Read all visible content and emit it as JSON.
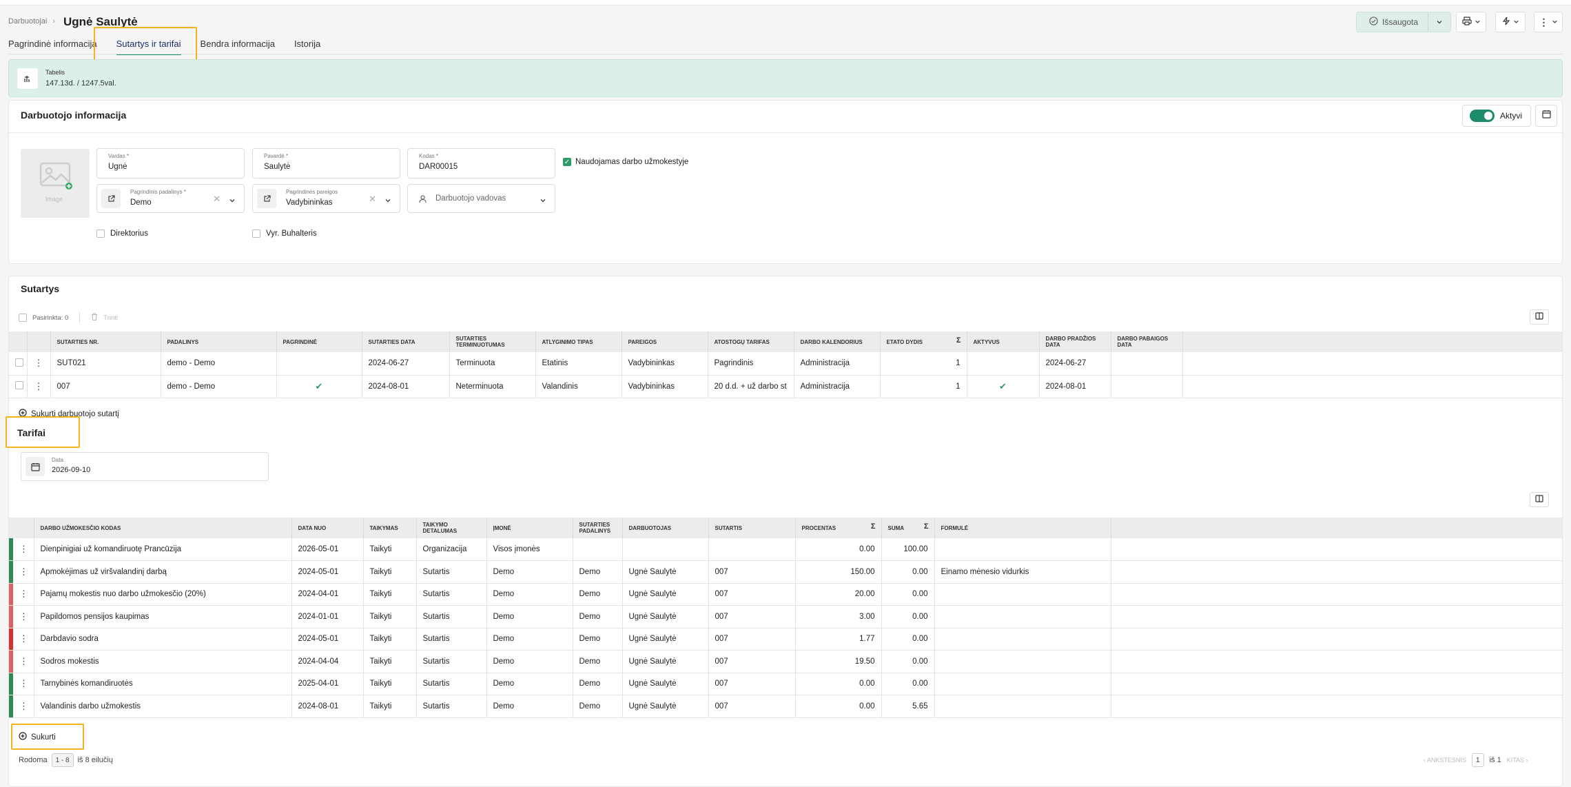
{
  "breadcrumb": {
    "parent": "Darbuotojai",
    "current": "Ugnė Saulytė"
  },
  "tabs": [
    "Pagrindinė informacija",
    "Sutartys ir tarifai",
    "Bendra informacija",
    "Istorija"
  ],
  "header_actions": {
    "saved_label": "Išsaugota"
  },
  "timesheet": {
    "title": "Tabelis",
    "value": "147.13d. / 1247.5val."
  },
  "employee_info": {
    "title": "Darbuotojo informacija",
    "active_label": "Aktyvi",
    "image_label": "Image",
    "first_name_label": "Vardas *",
    "first_name": "Ugnė",
    "last_name_label": "Pavardė *",
    "last_name": "Saulytė",
    "code_label": "Kodas *",
    "code": "DAR00015",
    "payroll_label": "Naudojamas darbo užmokestyje",
    "department_label": "Pagrindinis padalinys *",
    "department": "Demo",
    "position_label": "Pagrindinės pareigos",
    "position": "Vadybininkas",
    "manager_placeholder": "Darbuotojo vadovas",
    "director_label": "Direktorius",
    "accountant_label": "Vyr. Buhalteris"
  },
  "contracts": {
    "title": "Sutartys",
    "selected_label": "Pasirinkta: 0",
    "delete_label": "Trinti",
    "columns": [
      "Sutarties nr.",
      "Padalinys",
      "Pagrindinė",
      "Sutarties data",
      "Sutarties terminuotumas",
      "Atlyginimo tipas",
      "Pareigos",
      "Atostogų tarifas",
      "Darbo kalendorius",
      "Etato dydis",
      "Aktyvus",
      "Darbo pradžios data",
      "Darbo pabaigos data"
    ],
    "rows": [
      {
        "nr": "SUT021",
        "dept": "demo - Demo",
        "main": false,
        "date": "2024-06-27",
        "term": "Terminuota",
        "salary": "Etatinis",
        "position": "Vadybininkas",
        "vacation": "Pagrindinis",
        "calendar": "Administracija",
        "size": "1",
        "active": false,
        "start": "2024-06-27",
        "end": ""
      },
      {
        "nr": "007",
        "dept": "demo - Demo",
        "main": true,
        "date": "2024-08-01",
        "term": "Neterminuota",
        "salary": "Valandinis",
        "position": "Vadybininkas",
        "vacation": "20 d.d. + už darbo st",
        "calendar": "Administracija",
        "size": "1",
        "active": true,
        "start": "2024-08-01",
        "end": ""
      }
    ],
    "create_label": "Sukurti darbuotojo sutartį"
  },
  "rates": {
    "title": "Tarifai",
    "date_label": "Data",
    "date_value": "2026-09-10",
    "columns": [
      "Darbo užmokesčio kodas",
      "Data nuo",
      "Taikymas",
      "Taikymo detalumas",
      "Įmonė",
      "Sutarties padalinys",
      "Darbuotojas",
      "Sutartis",
      "Procentas",
      "Suma",
      "Formulė"
    ],
    "rows": [
      {
        "code": "Dienpinigiai už komandiruotę Prancūzija",
        "from": "2026-05-01",
        "apply": "Taikyti",
        "detail": "Organizacija",
        "company": "Visos įmonės",
        "dept": "",
        "employee": "",
        "contract": "",
        "percent": "0.00",
        "sum": "100.00",
        "formula": "",
        "color": "#2e8b57"
      },
      {
        "code": "Apmokėjimas už viršvalandinį darbą",
        "from": "2024-05-01",
        "apply": "Taikyti",
        "detail": "Sutartis",
        "company": "Demo",
        "dept": "Demo",
        "employee": "Ugnė Saulytė",
        "contract": "007",
        "percent": "150.00",
        "sum": "0.00",
        "formula": "Einamo mėnesio vidurkis",
        "color": "#2e8b57"
      },
      {
        "code": "Pajamų mokestis nuo darbo užmokesčio (20%)",
        "from": "2024-04-01",
        "apply": "Taikyti",
        "detail": "Sutartis",
        "company": "Demo",
        "dept": "Demo",
        "employee": "Ugnė Saulytė",
        "contract": "007",
        "percent": "20.00",
        "sum": "0.00",
        "formula": "",
        "color": "#e06060"
      },
      {
        "code": "Papildomos pensijos kaupimas",
        "from": "2024-01-01",
        "apply": "Taikyti",
        "detail": "Sutartis",
        "company": "Demo",
        "dept": "Demo",
        "employee": "Ugnė Saulytė",
        "contract": "007",
        "percent": "3.00",
        "sum": "0.00",
        "formula": "",
        "color": "#e06060"
      },
      {
        "code": "Darbdavio sodra",
        "from": "2024-05-01",
        "apply": "Taikyti",
        "detail": "Sutartis",
        "company": "Demo",
        "dept": "Demo",
        "employee": "Ugnė Saulytė",
        "contract": "007",
        "percent": "1.77",
        "sum": "0.00",
        "formula": "",
        "color": "#d93030"
      },
      {
        "code": "Sodros mokestis",
        "from": "2024-04-04",
        "apply": "Taikyti",
        "detail": "Sutartis",
        "company": "Demo",
        "dept": "Demo",
        "employee": "Ugnė Saulytė",
        "contract": "007",
        "percent": "19.50",
        "sum": "0.00",
        "formula": "",
        "color": "#e06060"
      },
      {
        "code": "Tarnybinės komandiruotės",
        "from": "2025-04-01",
        "apply": "Taikyti",
        "detail": "Sutartis",
        "company": "Demo",
        "dept": "Demo",
        "employee": "Ugnė Saulytė",
        "contract": "007",
        "percent": "0.00",
        "sum": "0.00",
        "formula": "",
        "color": "#2e8b57"
      },
      {
        "code": "Valandinis darbo užmokestis",
        "from": "2024-08-01",
        "apply": "Taikyti",
        "detail": "Sutartis",
        "company": "Demo",
        "dept": "Demo",
        "employee": "Ugnė Saulytė",
        "contract": "007",
        "percent": "0.00",
        "sum": "5.65",
        "formula": "",
        "color": "#2e8b57"
      }
    ],
    "create_label": "Sukurti"
  },
  "pagination": {
    "showing_label": "Rodoma",
    "range": "1 - 8",
    "of_rows": "iš 8 eilučių",
    "prev_label": "‹ ANKSTESNIS",
    "page": "1",
    "of_pages": "iš 1",
    "next_label": "KITAS ›"
  },
  "colors": {
    "accent": "#1e8a6a",
    "highlight": "#f6b21a",
    "banner_bg": "#dcefe8"
  }
}
